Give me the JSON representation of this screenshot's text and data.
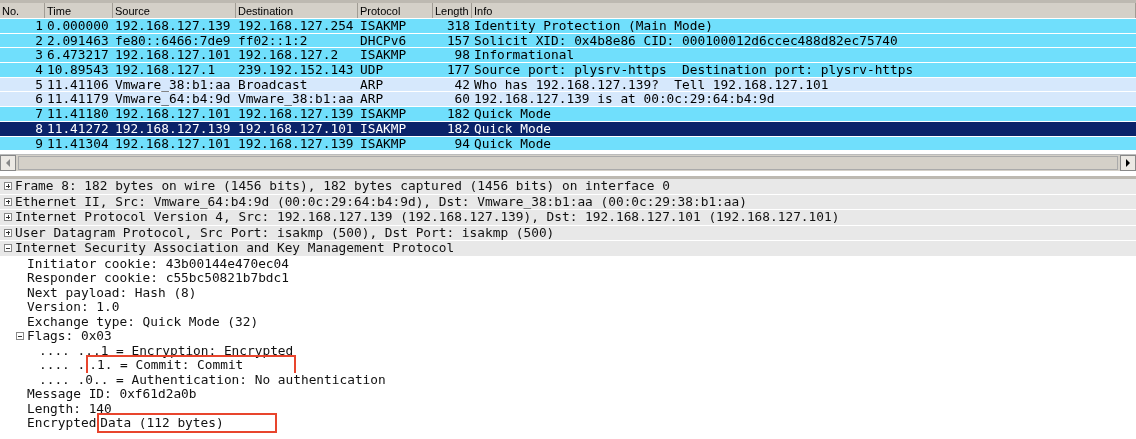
{
  "packet_list": {
    "columns": [
      "No.",
      "Time",
      "Source",
      "Destination",
      "Protocol",
      "Length",
      "Info"
    ],
    "rows": [
      {
        "no": "1",
        "time": "0.000000",
        "source": "192.168.127.139",
        "destination": "192.168.127.254",
        "protocol": "ISAKMP",
        "length": "318",
        "info": "Identity Protection (Main Mode)",
        "color": "#70dffc",
        "selected": false
      },
      {
        "no": "2",
        "time": "2.091463",
        "source": "fe80::6466:7de9",
        "destination": "ff02::1:2",
        "protocol": "DHCPv6",
        "length": "157",
        "info": "Solicit XID: 0x4b8e86 CID: 000100012d6ccec488d82ec75740",
        "color": "#70dffc",
        "selected": false
      },
      {
        "no": "3",
        "time": "6.473217",
        "source": "192.168.127.101",
        "destination": "192.168.127.2",
        "protocol": "ISAKMP",
        "length": "98",
        "info": "Informational",
        "color": "#70dffc",
        "selected": false
      },
      {
        "no": "4",
        "time": "10.89543",
        "source": "192.168.127.1",
        "destination": "239.192.152.143",
        "protocol": "UDP",
        "length": "177",
        "info": "Source port: plysrv-https  Destination port: plysrv-https",
        "color": "#70dffc",
        "selected": false
      },
      {
        "no": "5",
        "time": "11.41106",
        "source": "Vmware_38:b1:aa",
        "destination": "Broadcast",
        "protocol": "ARP",
        "length": "42",
        "info": "Who has 192.168.127.139?  Tell 192.168.127.101",
        "color": "#d6e8fc",
        "selected": false
      },
      {
        "no": "6",
        "time": "11.41179",
        "source": "Vmware_64:b4:9d",
        "destination": "Vmware_38:b1:aa",
        "protocol": "ARP",
        "length": "60",
        "info": "192.168.127.139 is at 00:0c:29:64:b4:9d",
        "color": "#d6e8fc",
        "selected": false
      },
      {
        "no": "7",
        "time": "11.41180",
        "source": "192.168.127.101",
        "destination": "192.168.127.139",
        "protocol": "ISAKMP",
        "length": "182",
        "info": "Quick Mode",
        "color": "#70dffc",
        "selected": false
      },
      {
        "no": "8",
        "time": "11.41272",
        "source": "192.168.127.139",
        "destination": "192.168.127.101",
        "protocol": "ISAKMP",
        "length": "182",
        "info": "Quick Mode",
        "selected": true
      },
      {
        "no": "9",
        "time": "11.41304",
        "source": "192.168.127.101",
        "destination": "192.168.127.139",
        "protocol": "ISAKMP",
        "length": "94",
        "info": "Quick Mode",
        "color": "#70dffc",
        "selected": false
      }
    ]
  },
  "details": [
    {
      "text": "Frame 8: 182 bytes on wire (1456 bits), 182 bytes captured (1456 bits) on interface 0",
      "expanded": false
    },
    {
      "text": "Ethernet II, Src: Vmware_64:b4:9d (00:0c:29:64:b4:9d), Dst: Vmware_38:b1:aa (00:0c:29:38:b1:aa)",
      "expanded": false
    },
    {
      "text": "Internet Protocol Version 4, Src: 192.168.127.139 (192.168.127.139), Dst: 192.168.127.101 (192.168.127.101)",
      "expanded": false
    },
    {
      "text": "User Datagram Protocol, Src Port: isakmp (500), Dst Port: isakmp (500)",
      "expanded": false
    },
    {
      "text": "Internet Security Association and Key Management Protocol",
      "expanded": true,
      "children": [
        {
          "text": "Initiator cookie: 43b00144e470ec04"
        },
        {
          "text": "Responder cookie: c55bc50821b7bdc1"
        },
        {
          "text": "Next payload: Hash (8)"
        },
        {
          "text": "Version: 1.0"
        },
        {
          "text": "Exchange type: Quick Mode (32)"
        },
        {
          "text": "Flags: 0x03",
          "expanded": true,
          "children": [
            {
              "text": ".... ...1 = Encryption: Encrypted"
            },
            {
              "text": ".... .",
              "highlight": ".1. = Commit: Commit"
            },
            {
              "text": ".... .0.. = Authentication: No authentication"
            }
          ]
        },
        {
          "text": "Message ID: 0xf61d2a0b"
        },
        {
          "text": "Length: 140"
        },
        {
          "text": "Encrypted ",
          "highlight": "Data (112 bytes)"
        }
      ]
    }
  ]
}
